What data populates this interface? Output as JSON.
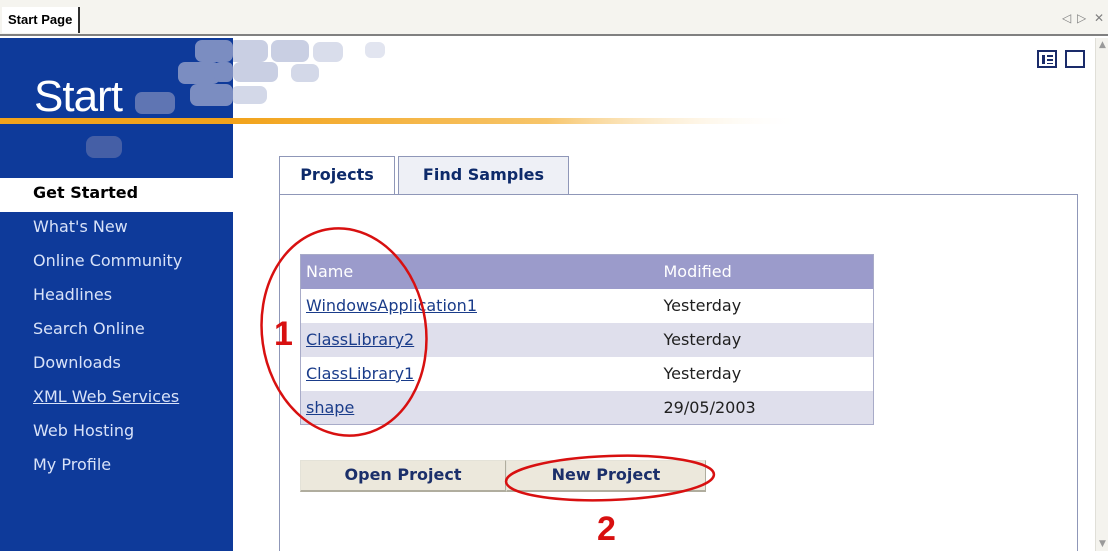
{
  "tabstrip": {
    "active_tab": "Start Page",
    "ctrl_left": "◁",
    "ctrl_right": "▷",
    "ctrl_close": "✕"
  },
  "banner": {
    "title": "Start"
  },
  "nav": {
    "items": [
      {
        "label": "Get Started"
      },
      {
        "label": "What's New"
      },
      {
        "label": "Online Community"
      },
      {
        "label": "Headlines"
      },
      {
        "label": "Search Online"
      },
      {
        "label": "Downloads"
      },
      {
        "label": "XML Web Services"
      },
      {
        "label": "Web Hosting"
      },
      {
        "label": "My Profile"
      }
    ]
  },
  "tabs": {
    "projects": "Projects",
    "find_samples": "Find Samples"
  },
  "projects_table": {
    "columns": {
      "name": "Name",
      "modified": "Modified"
    },
    "rows": [
      {
        "name": "WindowsApplication1",
        "modified": "Yesterday"
      },
      {
        "name": "ClassLibrary2",
        "modified": "Yesterday"
      },
      {
        "name": "ClassLibrary1",
        "modified": "Yesterday"
      },
      {
        "name": "shape",
        "modified": "29/05/2003"
      }
    ]
  },
  "buttons": {
    "open_project": "Open Project",
    "new_project": "New Project"
  },
  "annotations": {
    "label_1": "1",
    "label_2": "2"
  },
  "colors": {
    "nav_background": "#0e3a9a",
    "table_header": "#9b9bcb",
    "annotation": "#d81010"
  }
}
